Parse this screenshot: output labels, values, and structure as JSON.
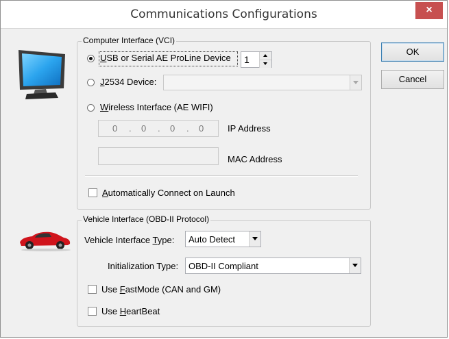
{
  "window": {
    "title": "Communications Configurations",
    "close_label": "×"
  },
  "computer_interface": {
    "legend": "Computer Interface (VCI)",
    "usb_pre": "",
    "usb_u": "U",
    "usb_post": "SB or Serial AE ProLine Device",
    "usb_selected": true,
    "device_count": "1",
    "j2534_u": "J",
    "j2534_post": "2534 Device:",
    "j2534_value": "",
    "wireless_u": "W",
    "wireless_post": "ireless Interface (AE WIFI)",
    "ip_octets": [
      "0",
      "0",
      "0",
      "0"
    ],
    "ip_dots": [
      ".",
      ".",
      "."
    ],
    "ip_label": "IP Address",
    "mac_value": "",
    "mac_label": "MAC Address",
    "auto_connect_u": "A",
    "auto_connect_post": "utomatically Connect on Launch"
  },
  "vehicle_interface": {
    "legend": "Vehicle Interface (OBD-II Protocol)",
    "type_pre": "Vehicle Interface ",
    "type_u": "T",
    "type_post": "ype:",
    "type_value": "Auto Detect",
    "init_label": "Initialization Type:",
    "init_value": "OBD-II Compliant",
    "fastmode_pre": "Use ",
    "fastmode_u": "F",
    "fastmode_post": "astMode (CAN and GM)",
    "heartbeat_pre": "Use ",
    "heartbeat_u": "H",
    "heartbeat_post": "eartBeat"
  },
  "buttons": {
    "ok": "OK",
    "cancel": "Cancel"
  },
  "icons": {
    "computer": "monitor-icon",
    "vehicle": "red-car-icon"
  },
  "colors": {
    "close": "#c75050",
    "default_border": "#3c7fb1"
  }
}
